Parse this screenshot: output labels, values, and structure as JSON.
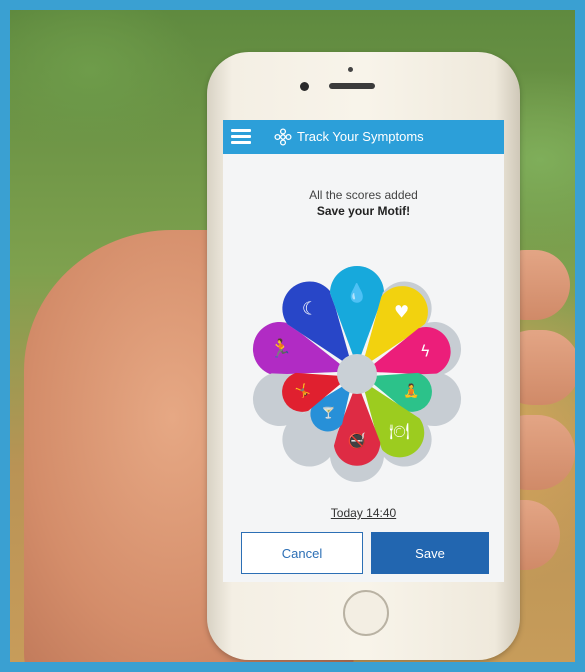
{
  "app": {
    "header_title": "Track Your Symptoms",
    "header_color": "#2c9fd9"
  },
  "screen": {
    "message_line1": "All the scores added",
    "message_line2": "Save your Motif!",
    "timestamp": "Today 14:40"
  },
  "buttons": {
    "cancel_label": "Cancel",
    "save_label": "Save",
    "save_color": "#2266b0"
  },
  "motif_segments": [
    {
      "name": "exercise",
      "icon": "running-icon",
      "color": "#b12bc4"
    },
    {
      "name": "sleep",
      "icon": "moon-stars-icon",
      "color": "#2846c8"
    },
    {
      "name": "hydration",
      "icon": "water-drop-icon",
      "color": "#17a9dc"
    },
    {
      "name": "mood",
      "icon": "heart-icon",
      "color": "#f2d20f"
    },
    {
      "name": "energy",
      "icon": "lightning-icon",
      "color": "#ec1e7a"
    },
    {
      "name": "stretching",
      "icon": "stretching-icon",
      "color": "#2cc28a"
    },
    {
      "name": "diet",
      "icon": "plate-cutlery-icon",
      "color": "#9ccc1f"
    },
    {
      "name": "no-smoking",
      "icon": "no-smoking-icon",
      "color": "#de2b44"
    },
    {
      "name": "no-alcohol",
      "icon": "no-drinks-icon",
      "color": "#2790d8"
    },
    {
      "name": "no-activity",
      "icon": "crossed-runner-icon",
      "color": "#e0202f"
    }
  ]
}
